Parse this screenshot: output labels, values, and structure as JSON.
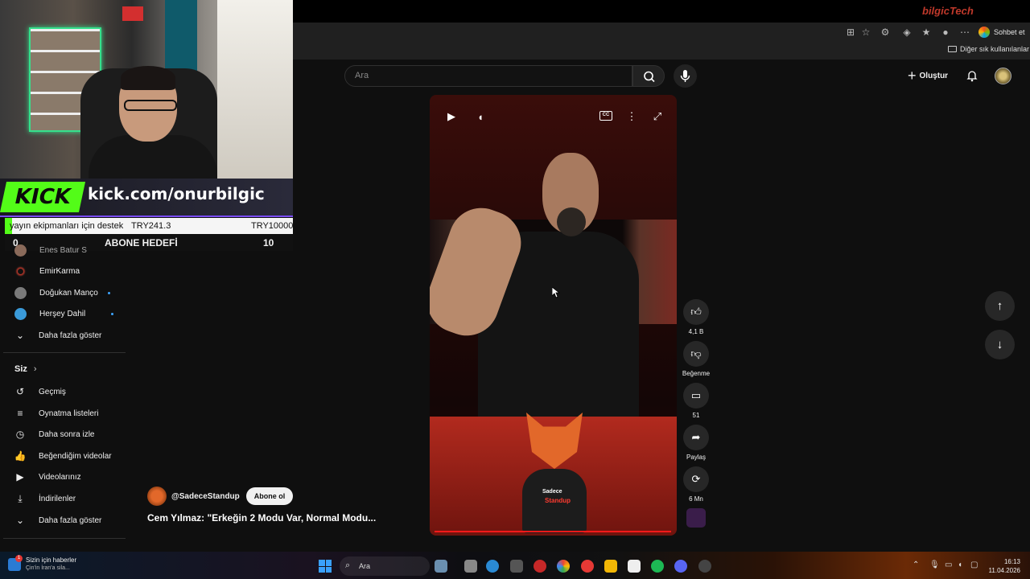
{
  "browser": {
    "chat_label": "Sohbet et",
    "other_bookmarks": "Diğer sık kullanılanlar",
    "site_logo": "bilgicTech"
  },
  "header": {
    "search_placeholder": "Ara",
    "create_label": "Oluştur"
  },
  "stream_overlay": {
    "kick_logo": "KICK",
    "kick_url": "kick.com/onurbilgic",
    "donation_label": "yayın ekipmanları için destek",
    "donation_current": "TRY241.3",
    "donation_goal": "TRY10000",
    "donation_progress_percent": 2.4,
    "sub_goal_current": "0",
    "sub_goal_title": "ABONE HEDEFİ",
    "sub_goal_target": "10"
  },
  "sidebar": {
    "subscriptions": [
      {
        "label": "Enes Batur S",
        "color": "#8a6a5a"
      },
      {
        "label": "EmirKarma",
        "color": "#c0392b"
      },
      {
        "label": "Doğukan Manço",
        "color": "#7a7a7a",
        "live": true
      },
      {
        "label": "Herşey Dahil",
        "color": "#3a9ad9",
        "live": true
      }
    ],
    "show_more_1": "Daha fazla göster",
    "you_section": "Siz",
    "you_items": [
      {
        "label": "Geçmiş",
        "icon": "history-icon"
      },
      {
        "label": "Oynatma listeleri",
        "icon": "playlist-icon"
      },
      {
        "label": "Daha sonra izle",
        "icon": "clock-icon"
      },
      {
        "label": "Beğendiğim videolar",
        "icon": "thumbs-up-icon"
      },
      {
        "label": "Videolarınız",
        "icon": "video-icon"
      },
      {
        "label": "İndirilenler",
        "icon": "download-icon"
      }
    ],
    "show_more_2": "Daha fazla göster"
  },
  "video": {
    "channel": "@SadeceStandup",
    "subscribe_label": "Abone ol",
    "title": "Cem Yılmaz: \"Erkeğin 2 Modu Var, Normal Modu...",
    "cc_label": "CC",
    "fox_shirt_line1": "Sadece",
    "fox_shirt_line2": "Standup"
  },
  "actions": {
    "likes": "4,1 B",
    "dislike_label": "Beğenme",
    "comments": "51",
    "share_label": "Paylaş",
    "remix_label": "6 Mn"
  },
  "taskbar": {
    "news_title": "Sizin için haberler",
    "news_sub": "Çin'in İran'a sila...",
    "news_badge": "1",
    "search_label": "Ara",
    "time": "16:13",
    "date": "11.04.2026"
  }
}
